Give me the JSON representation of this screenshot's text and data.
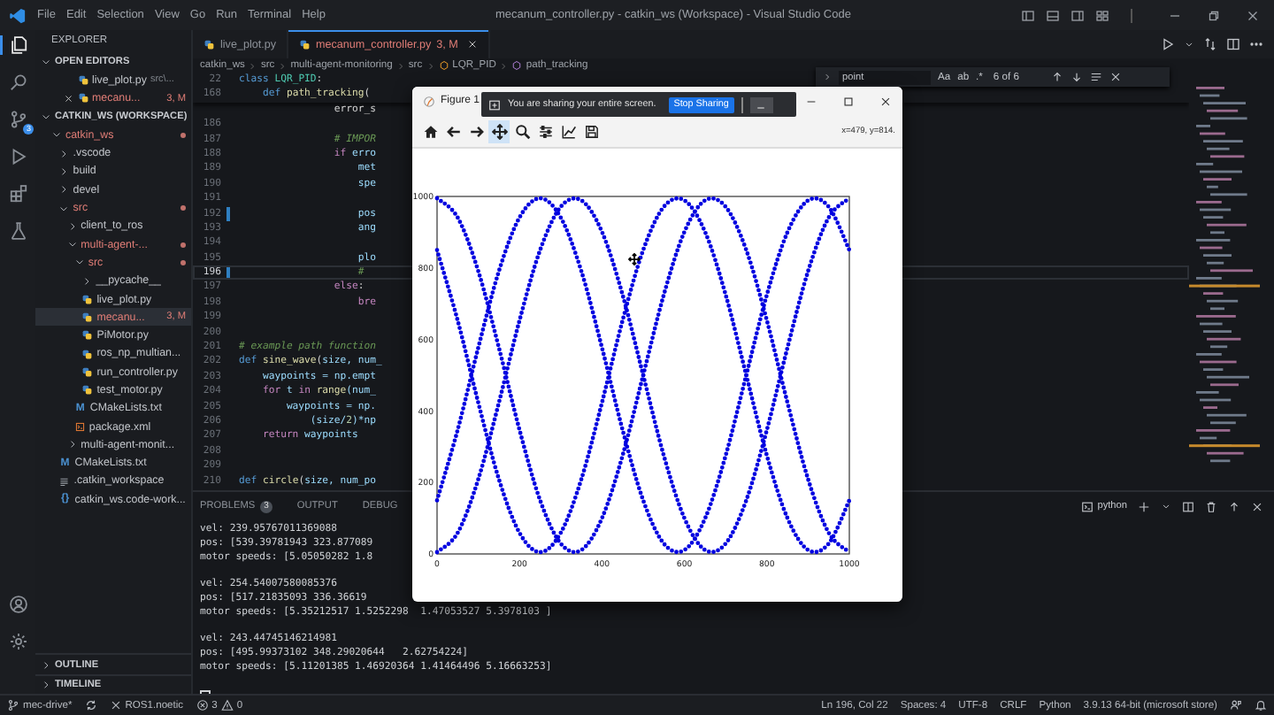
{
  "title_bar": {
    "menu": [
      "File",
      "Edit",
      "Selection",
      "View",
      "Go",
      "Run",
      "Terminal",
      "Help"
    ],
    "title": "mecanum_controller.py - catkin_ws (Workspace) - Visual Studio Code",
    "layout_buttons": [
      {
        "kind": "sidebar"
      },
      {
        "kind": "panel"
      },
      {
        "kind": "secondary"
      },
      {
        "kind": "customize"
      }
    ],
    "window_buttons": [
      {
        "kind": "minimize"
      },
      {
        "kind": "restore"
      },
      {
        "kind": "close"
      }
    ]
  },
  "activity_bar": {
    "items": [
      {
        "kind": "explorer",
        "selected": true
      },
      {
        "kind": "search",
        "selected": false
      },
      {
        "kind": "source_control",
        "selected": false,
        "badge": "3"
      },
      {
        "kind": "run",
        "selected": false
      },
      {
        "kind": "extensions",
        "selected": false
      },
      {
        "kind": "testing",
        "selected": false
      }
    ],
    "bottom": [
      {
        "kind": "account"
      },
      {
        "kind": "settings"
      }
    ]
  },
  "sidebar": {
    "title": "EXPLORER",
    "open_editors": {
      "label": "OPEN EDITORS",
      "expanded": true,
      "items": [
        {
          "label": "live_plot.py",
          "description": "src\\...",
          "kind": "python",
          "modified": false,
          "close": false,
          "selected": false
        },
        {
          "label": "mecanu...",
          "badge": "3, M",
          "kind": "python",
          "modified": true,
          "close": true,
          "selected": false
        }
      ]
    },
    "workspace": {
      "label": "CATKIN_WS (WORKSPACE)",
      "expanded": true,
      "tree": [
        {
          "label": "catkin_ws",
          "kind": "folder",
          "expanded": true,
          "modified": true,
          "selected": false,
          "children": [
            {
              "label": ".vscode",
              "kind": "folder",
              "expanded": false,
              "modified": false,
              "selected": false
            },
            {
              "label": "build",
              "kind": "folder",
              "expanded": false,
              "modified": false,
              "selected": false
            },
            {
              "label": "devel",
              "kind": "folder",
              "expanded": false,
              "modified": false,
              "selected": false
            },
            {
              "label": "src",
              "kind": "folder",
              "expanded": true,
              "modified": true,
              "selected": false,
              "children": [
                {
                  "label": "client_to_ros",
                  "kind": "folder",
                  "expanded": false,
                  "modified": false,
                  "selected": false
                },
                {
                  "label": "multi-agent-...",
                  "kind": "folder",
                  "expanded": true,
                  "modified": true,
                  "selected": false,
                  "children": [
                    {
                      "label": "src",
                      "kind": "folder",
                      "expanded": true,
                      "modified": true,
                      "selected": false,
                      "children": [
                        {
                          "label": "__pycache__",
                          "kind": "folder",
                          "expanded": false,
                          "modified": false,
                          "selected": false
                        },
                        {
                          "label": "live_plot.py",
                          "kind": "python",
                          "modified": false,
                          "selected": false
                        },
                        {
                          "label": "mecanu...",
                          "kind": "python",
                          "modified": true,
                          "badge": "3, M",
                          "selected": true
                        },
                        {
                          "label": "PiMotor.py",
                          "kind": "python",
                          "modified": false,
                          "selected": false
                        },
                        {
                          "label": "ros_np_multian...",
                          "kind": "python",
                          "modified": false,
                          "selected": false
                        },
                        {
                          "label": "run_controller.py",
                          "kind": "python",
                          "modified": false,
                          "selected": false
                        },
                        {
                          "label": "test_motor.py",
                          "kind": "python",
                          "modified": false,
                          "selected": false
                        }
                      ]
                    },
                    {
                      "label": "CMakeLists.txt",
                      "kind": "glyph",
                      "glyph": "M",
                      "modified": false,
                      "selected": false
                    },
                    {
                      "label": "package.xml",
                      "kind": "xml",
                      "modified": false,
                      "selected": false
                    }
                  ]
                },
                {
                  "label": "multi-agent-monit...",
                  "kind": "folder",
                  "expanded": false,
                  "modified": false,
                  "selected": false
                }
              ]
            },
            {
              "label": "CMakeLists.txt",
              "kind": "glyph",
              "glyph": "M",
              "modified": false,
              "selected": false
            },
            {
              "label": ".catkin_workspace",
              "kind": "lines",
              "modified": false,
              "selected": false
            },
            {
              "label": "catkin_ws.code-work...",
              "kind": "glyph",
              "glyph": "{}",
              "modified": false,
              "selected": false
            }
          ]
        }
      ]
    },
    "bottom_sections": [
      {
        "label": "OUTLINE",
        "expanded": false
      },
      {
        "label": "TIMELINE",
        "expanded": false
      }
    ]
  },
  "editor": {
    "tabs": [
      {
        "label": "live_plot.py",
        "kind": "python",
        "selected": false
      },
      {
        "label": "mecanum_controller.py",
        "badge": "3, M",
        "kind": "python",
        "selected": true
      }
    ],
    "actions": [
      {
        "kind": "run"
      },
      {
        "kind": "caret"
      },
      {
        "kind": "compare"
      },
      {
        "kind": "split"
      },
      {
        "kind": "more"
      }
    ],
    "breadcrumbs": [
      {
        "label": "catkin_ws",
        "kind": "folder"
      },
      {
        "label": "src",
        "kind": "folder"
      },
      {
        "label": "multi-agent-monitoring",
        "kind": "folder"
      },
      {
        "label": "src",
        "kind": "folder"
      },
      {
        "label": "LQR_PID",
        "kind": "class"
      },
      {
        "label": "path_tracking",
        "kind": "method"
      }
    ],
    "sticky": [
      {
        "number": "22",
        "tokens": [
          {
            "text": "class ",
            "kind": "keyword"
          },
          {
            "text": "LQR_PID",
            "kind": "type"
          },
          {
            "text": ":",
            "kind": "plain"
          }
        ]
      },
      {
        "number": "168",
        "tokens": [
          {
            "text": "    def ",
            "kind": "keyword"
          },
          {
            "text": "path_tracking",
            "kind": "function"
          },
          {
            "text": "(",
            "kind": "plain"
          }
        ]
      }
    ],
    "lines": [
      {
        "current": false,
        "changed": false,
        "tokens": [
          {
            "text": "                error_s",
            "kind": "plain"
          }
        ]
      },
      {
        "number": "186",
        "current": false,
        "changed": false
      },
      {
        "number": "187",
        "current": false,
        "changed": false,
        "tokens": [
          {
            "text": "                # IMPOR",
            "kind": "comment"
          }
        ]
      },
      {
        "number": "188",
        "current": false,
        "changed": false,
        "tokens": [
          {
            "text": "                if ",
            "kind": "control"
          },
          {
            "text": "erro",
            "kind": "variable"
          }
        ]
      },
      {
        "number": "189",
        "current": false,
        "changed": false,
        "tokens": [
          {
            "text": "                    met",
            "kind": "variable"
          }
        ]
      },
      {
        "number": "190",
        "current": false,
        "changed": false,
        "tokens": [
          {
            "text": "                    spe",
            "kind": "variable"
          }
        ]
      },
      {
        "number": "191",
        "current": false,
        "changed": false
      },
      {
        "number": "192",
        "current": false,
        "changed": true,
        "tokens": [
          {
            "text": "                    pos",
            "kind": "variable"
          }
        ]
      },
      {
        "number": "193",
        "current": false,
        "changed": false,
        "tokens": [
          {
            "text": "                    ang",
            "kind": "variable"
          }
        ]
      },
      {
        "number": "194",
        "current": false,
        "changed": false
      },
      {
        "number": "195",
        "current": false,
        "changed": false,
        "tokens": [
          {
            "text": "                    plo",
            "kind": "variable"
          }
        ]
      },
      {
        "number": "196",
        "current": true,
        "changed": true,
        "tokens": [
          {
            "text": "                    #",
            "kind": "comment"
          }
        ]
      },
      {
        "number": "197",
        "current": false,
        "changed": false,
        "tokens": [
          {
            "text": "                else",
            "kind": "control"
          },
          {
            "text": ":",
            "kind": "plain"
          }
        ]
      },
      {
        "number": "198",
        "current": false,
        "changed": false,
        "tokens": [
          {
            "text": "                    bre",
            "kind": "control"
          }
        ]
      },
      {
        "number": "199",
        "current": false,
        "changed": false
      },
      {
        "number": "200",
        "current": false,
        "changed": false
      },
      {
        "number": "201",
        "current": false,
        "changed": false,
        "tokens": [
          {
            "text": "# example path function",
            "kind": "comment"
          }
        ]
      },
      {
        "number": "202",
        "current": false,
        "changed": false,
        "tokens": [
          {
            "text": "def ",
            "kind": "keyword"
          },
          {
            "text": "sine_wave",
            "kind": "function"
          },
          {
            "text": "(",
            "kind": "plain"
          },
          {
            "text": "size, num_",
            "kind": "variable"
          }
        ]
      },
      {
        "number": "203",
        "current": false,
        "changed": false,
        "tokens": [
          {
            "text": "    waypoints = np.empt",
            "kind": "variable"
          }
        ]
      },
      {
        "number": "204",
        "current": false,
        "changed": false,
        "tokens": [
          {
            "text": "    for ",
            "kind": "control"
          },
          {
            "text": "t ",
            "kind": "variable"
          },
          {
            "text": "in ",
            "kind": "control"
          },
          {
            "text": "range",
            "kind": "function"
          },
          {
            "text": "(num_",
            "kind": "variable"
          }
        ]
      },
      {
        "number": "205",
        "current": false,
        "changed": false,
        "tokens": [
          {
            "text": "        waypoints = np.",
            "kind": "variable"
          }
        ]
      },
      {
        "number": "206",
        "current": false,
        "changed": false,
        "tokens": [
          {
            "text": "            (size/",
            "kind": "variable"
          },
          {
            "text": "2",
            "kind": "number"
          },
          {
            "text": ")*np",
            "kind": "variable"
          }
        ]
      },
      {
        "number": "207",
        "current": false,
        "changed": false,
        "tokens": [
          {
            "text": "    return ",
            "kind": "control"
          },
          {
            "text": "waypoints",
            "kind": "variable"
          }
        ]
      },
      {
        "number": "208",
        "current": false,
        "changed": false
      },
      {
        "number": "209",
        "current": false,
        "changed": false
      },
      {
        "number": "210",
        "current": false,
        "changed": false,
        "tokens": [
          {
            "text": "def ",
            "kind": "keyword"
          },
          {
            "text": "circle",
            "kind": "function"
          },
          {
            "text": "(",
            "kind": "plain"
          },
          {
            "text": "size, num_po",
            "kind": "variable"
          }
        ]
      }
    ],
    "find": {
      "value": "point",
      "options": [
        {
          "label": "Aa"
        },
        {
          "label": "ab"
        },
        {
          "label": ".*"
        }
      ],
      "result": "6 of 6",
      "buttons": [
        {
          "kind": "up"
        },
        {
          "kind": "down"
        },
        {
          "kind": "selection"
        },
        {
          "kind": "close"
        }
      ]
    }
  },
  "panel": {
    "tabs": [
      {
        "label": "PROBLEMS",
        "badge": "3",
        "selected": false
      },
      {
        "label": "OUTPUT",
        "selected": false
      },
      {
        "label": "DEBUG",
        "selected": false
      }
    ],
    "terminal_name": "python",
    "actions": [
      {
        "kind": "plus"
      },
      {
        "kind": "caret"
      },
      {
        "kind": "split"
      },
      {
        "kind": "trash"
      },
      {
        "kind": "up"
      },
      {
        "kind": "close"
      }
    ],
    "terminal_blocks": [
      [
        "vel: 239.95767011369088",
        "pos: [539.39781943 323.877089",
        "motor speeds: [5.05050282 1.8"
      ],
      [
        "vel: 254.54007580085376",
        "pos: [517.21835093 336.36619",
        "motor speeds: [5.35212517 1.5252298  1.47053527 5.3978103 ]"
      ],
      [
        "vel: 243.44745146214981",
        "pos: [495.99373102 348.29020644   2.62754224]",
        "motor speeds: [5.11201385 1.46920364 1.41464496 5.16663253]"
      ]
    ],
    "cursor": true
  },
  "status_bar": {
    "left": [
      {
        "kind": "branch",
        "label": "mec-drive*"
      },
      {
        "kind": "sync"
      },
      {
        "kind": "remote",
        "label": "ROS1.noetic"
      },
      {
        "kind": "problems",
        "errors": "3",
        "warnings": "0"
      }
    ],
    "right": [
      {
        "kind": "text",
        "label": "Ln 196, Col 22"
      },
      {
        "kind": "text",
        "label": "Spaces: 4"
      },
      {
        "kind": "text",
        "label": "UTF-8"
      },
      {
        "kind": "text",
        "label": "CRLF"
      },
      {
        "kind": "text",
        "label": "Python"
      },
      {
        "kind": "text",
        "label": "3.9.13 64-bit (microsoft store)"
      },
      {
        "kind": "feedback"
      },
      {
        "kind": "bell"
      }
    ]
  },
  "figure": {
    "title": "Figure 1",
    "window_buttons": [
      {
        "kind": "minimize"
      },
      {
        "kind": "maximize"
      },
      {
        "kind": "close"
      }
    ],
    "toolbar": [
      {
        "kind": "home",
        "selected": false
      },
      {
        "kind": "back",
        "selected": false
      },
      {
        "kind": "forward",
        "selected": false
      },
      {
        "kind": "pan",
        "selected": true
      },
      {
        "kind": "zoom",
        "selected": false
      },
      {
        "kind": "sliders",
        "selected": false
      },
      {
        "kind": "edit_axes",
        "selected": false
      },
      {
        "kind": "save",
        "selected": false
      }
    ],
    "coords": "x=479, y=814.",
    "chart_data": {
      "type": "line",
      "x": [
        0,
        50,
        100,
        150,
        200,
        250,
        300,
        350,
        400,
        450,
        500,
        550,
        600,
        650,
        700,
        750,
        800,
        850,
        900,
        950,
        1000
      ],
      "series": [
        {
          "color": "#0000e0",
          "line_style": "dotted",
          "values": [
            995,
            941,
            791,
            577,
            347,
            150,
            29,
            11,
            100,
            275,
            500,
            725,
            901,
            989,
            971,
            850,
            653,
            423,
            209,
            59,
            5
          ]
        },
        {
          "color": "#0000e0",
          "line_style": "dotted",
          "values": [
            5,
            59,
            209,
            423,
            653,
            850,
            971,
            989,
            901,
            725,
            500,
            275,
            100,
            11,
            29,
            150,
            347,
            577,
            791,
            941,
            995
          ]
        },
        {
          "color": "#0000e0",
          "line_style": "dotted",
          "values": [
            850,
            653,
            423,
            209,
            59,
            5,
            59,
            209,
            423,
            653,
            850,
            971,
            989,
            901,
            725,
            500,
            275,
            100,
            11,
            29,
            150
          ]
        },
        {
          "color": "#0000e0",
          "line_style": "dotted",
          "values": [
            150,
            347,
            577,
            791,
            941,
            995,
            941,
            791,
            577,
            347,
            150,
            29,
            11,
            99,
            275,
            500,
            725,
            900,
            989,
            971,
            850
          ]
        }
      ],
      "xlim": [
        0,
        1000
      ],
      "ylim": [
        0,
        1000
      ],
      "xticks": [
        0,
        200,
        400,
        600,
        800,
        1000
      ],
      "yticks": [
        0,
        200,
        400,
        600,
        800,
        1000
      ]
    }
  },
  "sharing_bar": {
    "message": "You are sharing your entire screen.",
    "stop_label": "Stop Sharing"
  }
}
